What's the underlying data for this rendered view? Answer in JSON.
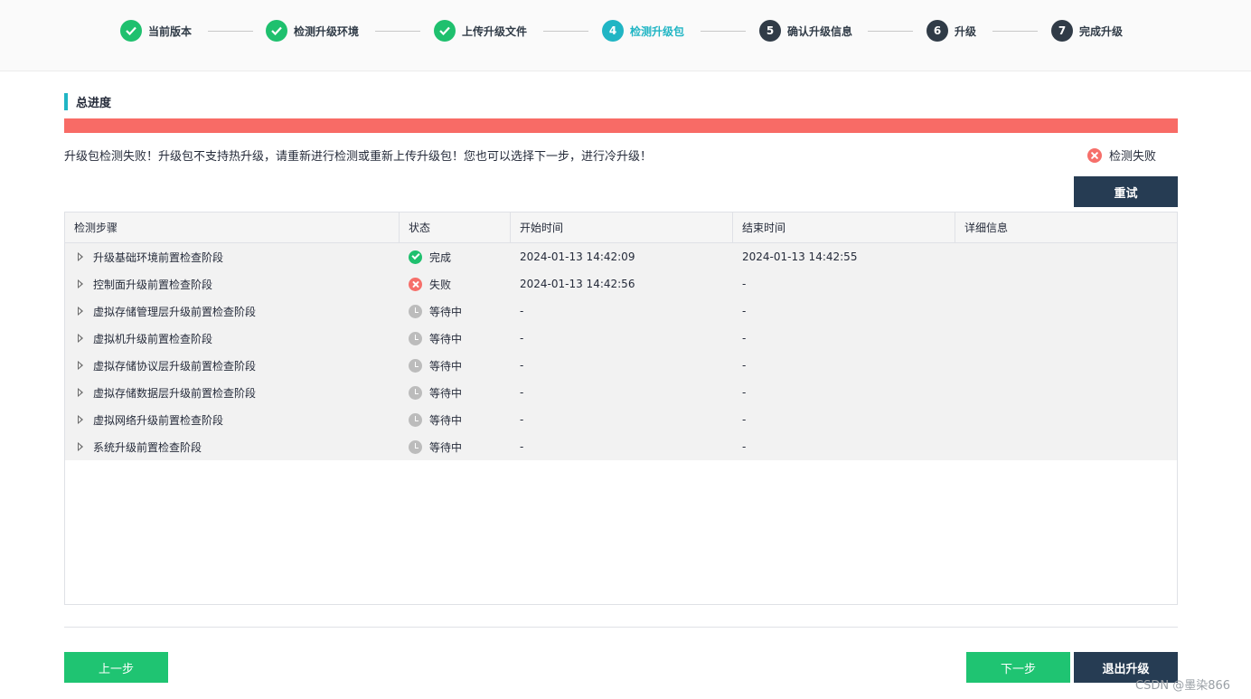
{
  "steps": [
    {
      "label": "当前版本",
      "num": "1",
      "state": "done"
    },
    {
      "label": "检测升级环境",
      "num": "2",
      "state": "done"
    },
    {
      "label": "上传升级文件",
      "num": "3",
      "state": "done"
    },
    {
      "label": "检测升级包",
      "num": "4",
      "state": "active"
    },
    {
      "label": "确认升级信息",
      "num": "5",
      "state": "todo"
    },
    {
      "label": "升级",
      "num": "6",
      "state": "todo"
    },
    {
      "label": "完成升级",
      "num": "7",
      "state": "todo"
    }
  ],
  "section_title": "总进度",
  "progress": {
    "fraction": 1.0,
    "color": "#f86b66"
  },
  "message": "升级包检测失败！升级包不支持热升级，请重新进行检测或重新上传升级包！您也可以选择下一步，进行冷升级！",
  "status_text": "检测失败",
  "retry_button": "重试",
  "table": {
    "headers": [
      "检测步骤",
      "状态",
      "开始时间",
      "结束时间",
      "详细信息"
    ],
    "rows": [
      {
        "name": "升级基础环境前置检查阶段",
        "status": "完成",
        "status_icon": "check-circle-icon",
        "start": "2024-01-13 14:42:09",
        "end": "2024-01-13 14:42:55",
        "detail": ""
      },
      {
        "name": "控制面升级前置检查阶段",
        "status": "失败",
        "status_icon": "error-circle-icon",
        "start": "2024-01-13 14:42:56",
        "end": "-",
        "detail": ""
      },
      {
        "name": "虚拟存储管理层升级前置检查阶段",
        "status": "等待中",
        "status_icon": "clock-icon",
        "start": "-",
        "end": "-",
        "detail": ""
      },
      {
        "name": "虚拟机升级前置检查阶段",
        "status": "等待中",
        "status_icon": "clock-icon",
        "start": "-",
        "end": "-",
        "detail": ""
      },
      {
        "name": "虚拟存储协议层升级前置检查阶段",
        "status": "等待中",
        "status_icon": "clock-icon",
        "start": "-",
        "end": "-",
        "detail": ""
      },
      {
        "name": "虚拟存储数据层升级前置检查阶段",
        "status": "等待中",
        "status_icon": "clock-icon",
        "start": "-",
        "end": "-",
        "detail": ""
      },
      {
        "name": "虚拟网络升级前置检查阶段",
        "status": "等待中",
        "status_icon": "clock-icon",
        "start": "-",
        "end": "-",
        "detail": ""
      },
      {
        "name": "系统升级前置检查阶段",
        "status": "等待中",
        "status_icon": "clock-icon",
        "start": "-",
        "end": "-",
        "detail": ""
      }
    ]
  },
  "footer": {
    "prev_label": "上一步",
    "next_label": "下一步",
    "exit_label": "退出升级"
  },
  "watermark": "CSDN @墨染866",
  "colors": {
    "accent": "#20b5c4",
    "success": "#1fc06e",
    "danger": "#f66f6a",
    "dark_button": "#263c53",
    "green_button": "#1fc472"
  }
}
